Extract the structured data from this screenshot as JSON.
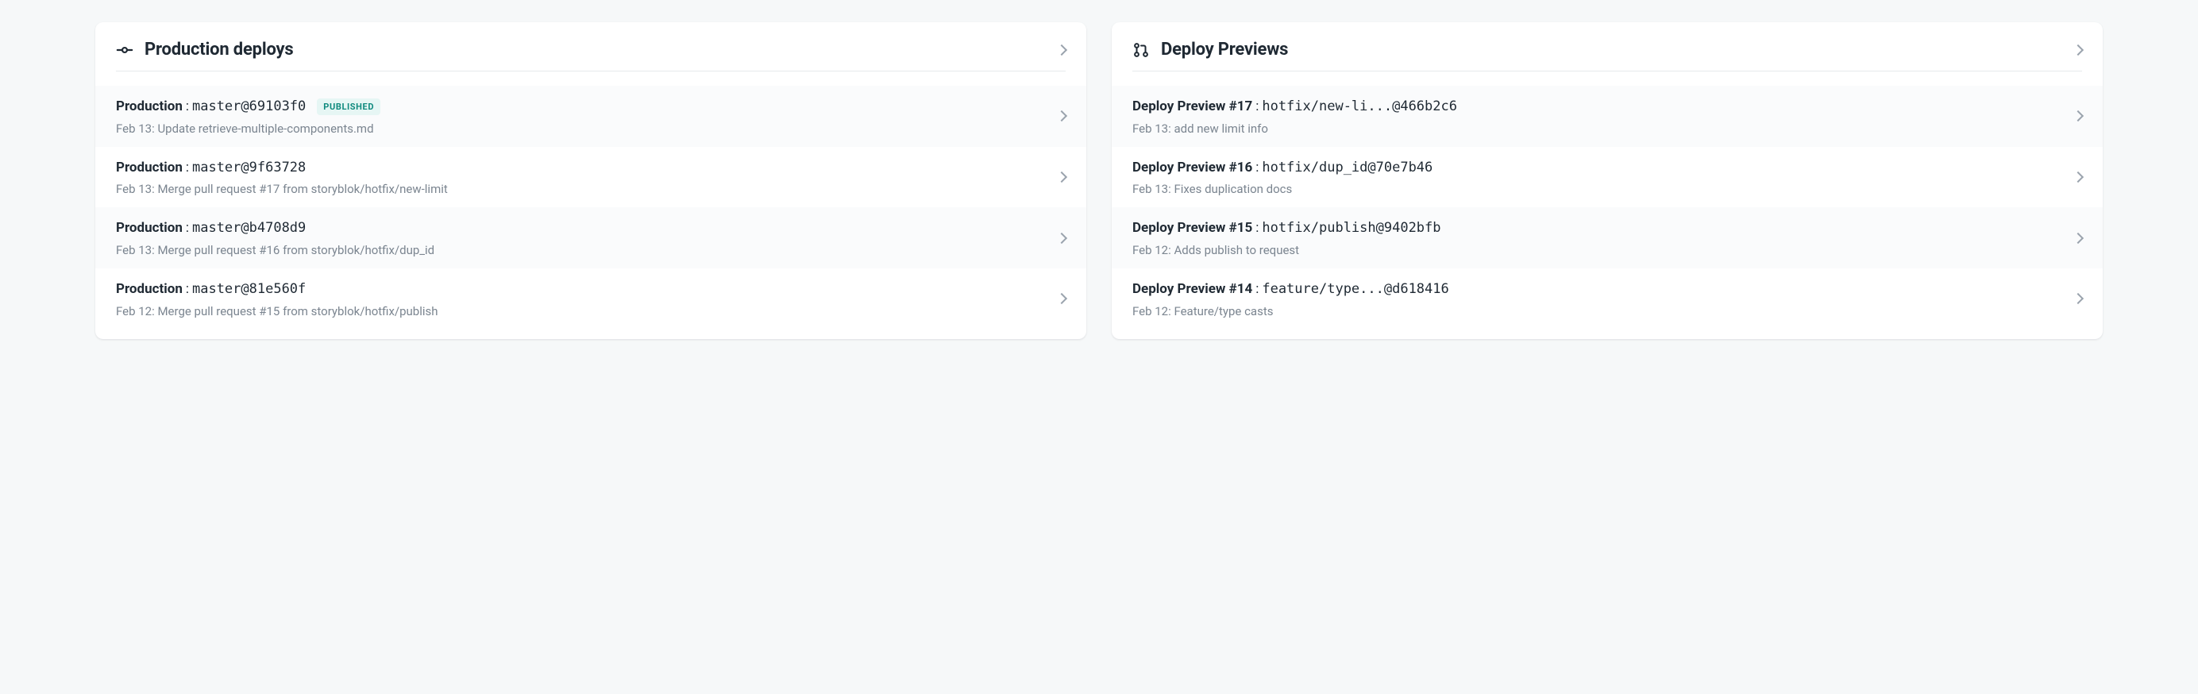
{
  "production": {
    "title": "Production deploys",
    "items": [
      {
        "label": "Production",
        "detail": "master@69103f0",
        "badge": "PUBLISHED",
        "sub": "Feb 13: Update retrieve-multiple-components.md"
      },
      {
        "label": "Production",
        "detail": "master@9f63728",
        "sub": "Feb 13: Merge pull request #17 from storyblok/hotfix/new-limit"
      },
      {
        "label": "Production",
        "detail": "master@b4708d9",
        "sub": "Feb 13: Merge pull request #16 from storyblok/hotfix/dup_id"
      },
      {
        "label": "Production",
        "detail": "master@81e560f",
        "sub": "Feb 12: Merge pull request #15 from storyblok/hotfix/publish"
      }
    ]
  },
  "previews": {
    "title": "Deploy Previews",
    "items": [
      {
        "label": "Deploy Preview #17",
        "detail": "hotfix/new-li...@466b2c6",
        "sub": "Feb 13: add new limit info"
      },
      {
        "label": "Deploy Preview #16",
        "detail": "hotfix/dup_id@70e7b46",
        "sub": "Feb 13: Fixes duplication docs"
      },
      {
        "label": "Deploy Preview #15",
        "detail": "hotfix/publish@9402bfb",
        "sub": "Feb 12: Adds publish to request"
      },
      {
        "label": "Deploy Preview #14",
        "detail": "feature/type...@d618416",
        "sub": "Feb 12: Feature/type casts"
      }
    ]
  }
}
